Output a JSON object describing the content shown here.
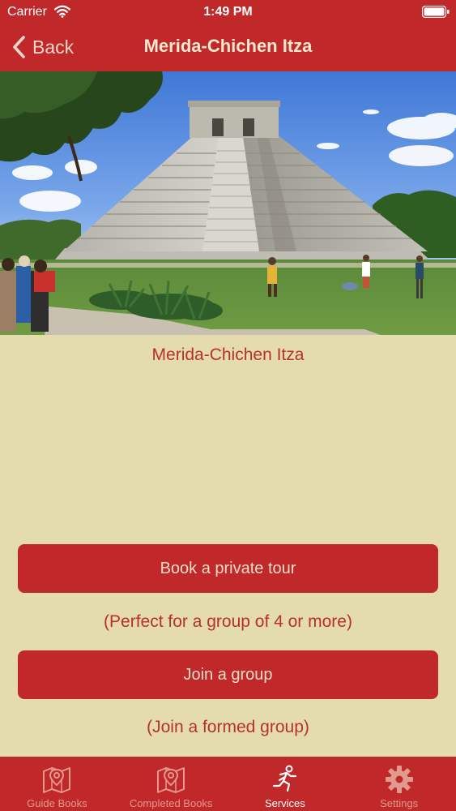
{
  "status_bar": {
    "carrier": "Carrier",
    "time": "1:49 PM"
  },
  "nav": {
    "back_label": "Back",
    "title": "Merida-Chichen Itza"
  },
  "hero": {
    "image_name": "pyramid-photo"
  },
  "content": {
    "place_title": "Merida-Chichen Itza",
    "private_tour_label": "Book a private tour",
    "private_tour_hint": "(Perfect for a group of 4 or more)",
    "join_group_label": "Join a group",
    "join_group_hint": "(Join a formed group)"
  },
  "tab_bar": {
    "tabs": [
      {
        "label": "Guide Books",
        "icon": "map-pin-icon",
        "active": false
      },
      {
        "label": "Completed Books",
        "icon": "map-pin-icon",
        "active": false
      },
      {
        "label": "Services",
        "icon": "running-person-icon",
        "active": true
      },
      {
        "label": "Settings",
        "icon": "gear-icon",
        "active": false
      }
    ]
  },
  "colors": {
    "primary_red": "#c0282a",
    "background": "#e4dcaf",
    "text_red": "#b8302b"
  }
}
